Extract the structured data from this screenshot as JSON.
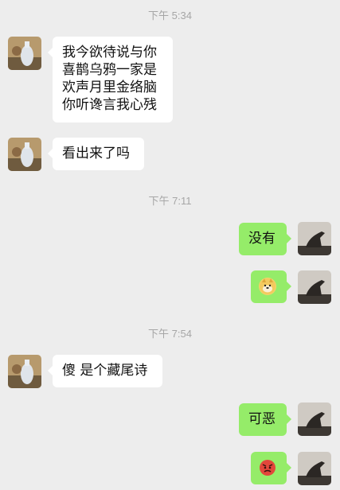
{
  "timestamps": [
    "下午 5:34",
    "下午 7:11",
    "下午 7:54"
  ],
  "messages": {
    "m1": {
      "lines": [
        "我今欲待说与你",
        "喜鹊乌鸦一家是",
        "欢声月里金络脑",
        "你听谗言我心残"
      ]
    },
    "m2": {
      "text": "看出来了吗"
    },
    "m3": {
      "text": "没有"
    },
    "m4": {
      "emoji": "doge-emoji"
    },
    "m5": {
      "text": "傻 是个藏尾诗"
    },
    "m6": {
      "text": "可恶"
    },
    "m7": {
      "emoji": "angry-face-emoji"
    }
  },
  "colors": {
    "background": "#ededed",
    "outgoing_bubble": "#95ec69",
    "incoming_bubble": "#ffffff",
    "timestamp_text": "#a6a6a6"
  }
}
